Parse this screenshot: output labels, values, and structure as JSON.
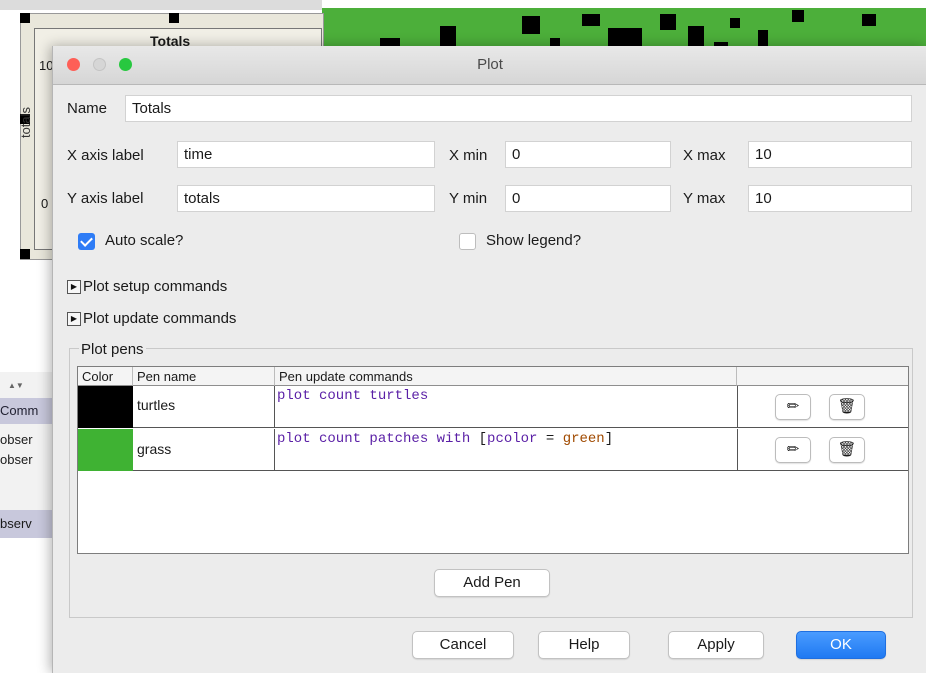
{
  "background": {
    "plot_title": "Totals",
    "plot_axis_rot": "totals",
    "y_top": "10",
    "y_bottom": "0",
    "command_center_label": "Comm",
    "observer_line_1": "obser",
    "observer_line_2": "obser",
    "observer_input": "bserv"
  },
  "dialog": {
    "title": "Plot",
    "name_label": "Name",
    "name_value": "Totals",
    "x_axis_label": "X axis label",
    "x_axis_value": "time",
    "xmin_label": "X min",
    "xmin_value": "0",
    "xmax_label": "X max",
    "xmax_value": "10",
    "y_axis_label": "Y axis label",
    "y_axis_value": "totals",
    "ymin_label": "Y min",
    "ymin_value": "0",
    "ymax_label": "Y max",
    "ymax_value": "10",
    "auto_scale_label": "Auto scale?",
    "auto_scale_checked": true,
    "show_legend_label": "Show legend?",
    "show_legend_checked": false,
    "setup_commands_label": "Plot setup commands",
    "update_commands_label": "Plot update commands",
    "pens_group_label": "Plot pens",
    "table_headers": [
      "Color",
      "Pen name",
      "Pen update commands"
    ],
    "pens": [
      {
        "color": "#000000",
        "name": "turtles",
        "command_parts": [
          "plot count turtles"
        ]
      },
      {
        "color": "#3fb233",
        "name": "grass",
        "command_parts": [
          "plot count patches with ",
          "[",
          "pcolor",
          " = ",
          "green",
          "]"
        ]
      }
    ],
    "add_pen_label": "Add Pen",
    "buttons": {
      "cancel": "Cancel",
      "help": "Help",
      "apply": "Apply",
      "ok": "OK"
    }
  },
  "icons": {
    "edit": "pencil-icon",
    "delete": "trash-icon",
    "disclosure": "triangle-right-icon"
  },
  "colors": {
    "accent": "#2e7cf6",
    "world_green": "#4caf3a",
    "close": "#fe5f57",
    "minimize": "#d6d6d6",
    "zoom": "#28c840"
  }
}
